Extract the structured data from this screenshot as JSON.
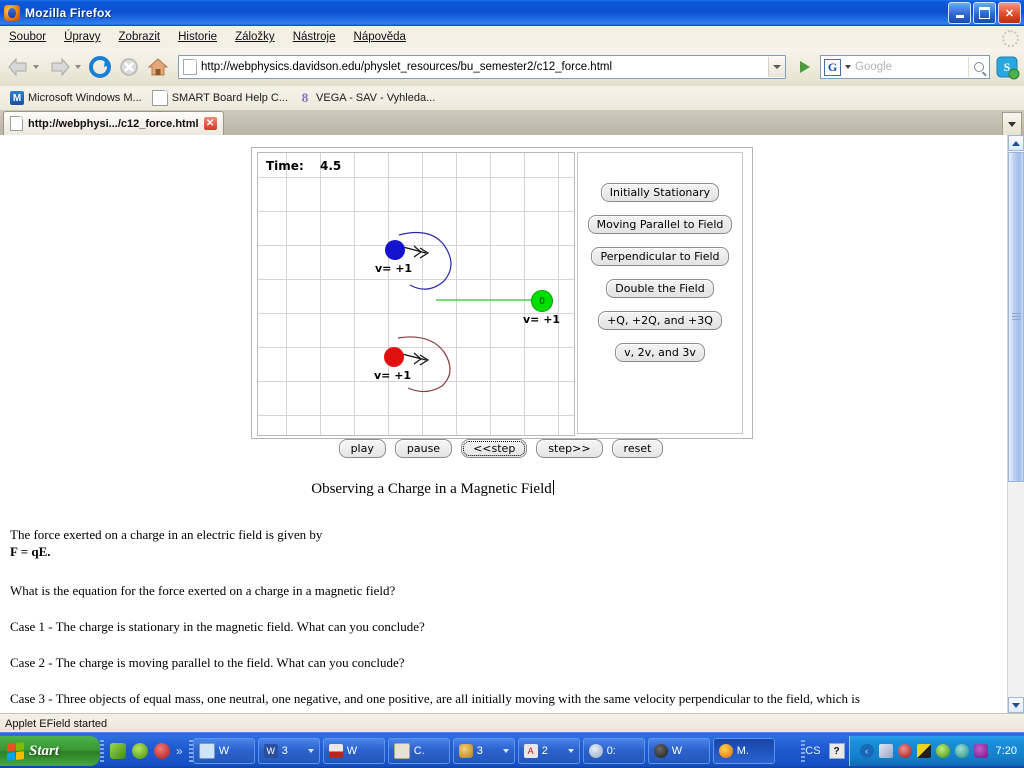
{
  "window": {
    "title": "Mozilla Firefox",
    "minimize_label": "_",
    "maximize_label": "□",
    "close_label": "✕"
  },
  "menubar": {
    "items": [
      {
        "label": "Soubor"
      },
      {
        "label": "Úpravy"
      },
      {
        "label": "Zobrazit"
      },
      {
        "label": "Historie"
      },
      {
        "label": "Záložky"
      },
      {
        "label": "Nástroje"
      },
      {
        "label": "Nápověda"
      }
    ]
  },
  "navbar": {
    "back_title": "Back",
    "forward_title": "Forward",
    "reload_title": "Reload",
    "stop_title": "Stop",
    "home_title": "Home",
    "url": "http://webphysics.davidson.edu/physlet_resources/bu_semester2/c12_force.html",
    "go_title": "Go",
    "search_engine": "G",
    "search_placeholder": "Google",
    "search_value": ""
  },
  "bookmarks": [
    {
      "label": "Microsoft Windows M...",
      "icon": "m-icon"
    },
    {
      "label": "SMART Board Help C...",
      "icon": "page-icon"
    },
    {
      "label": "VEGA - SAV - Vyhleda...",
      "icon": "eight-icon"
    }
  ],
  "tabs": [
    {
      "label": "http://webphysi.../c12_force.html",
      "close_label": "✕"
    }
  ],
  "applet": {
    "time_label": "Time:",
    "time_value": "4.5",
    "objects": [
      {
        "name": "blue-charge",
        "color": "#1414cc",
        "velocity_label": "v= +1",
        "inner": ""
      },
      {
        "name": "green-charge",
        "color": "#00e000",
        "velocity_label": "v= +1",
        "inner": "0"
      },
      {
        "name": "red-charge",
        "color": "#e11010",
        "velocity_label": "v= +1",
        "inner": ""
      }
    ],
    "scenario_buttons": [
      {
        "label": "Initially Stationary"
      },
      {
        "label": "Moving Parallel to Field"
      },
      {
        "label": "Perpendicular to Field"
      },
      {
        "label": "Double the Field"
      },
      {
        "label": "+Q, +2Q, and +3Q"
      },
      {
        "label": "v, 2v, and 3v"
      }
    ],
    "playback_buttons": [
      {
        "label": "play",
        "focused": false
      },
      {
        "label": "pause",
        "focused": false
      },
      {
        "label": "<<step",
        "focused": true
      },
      {
        "label": "step>>",
        "focused": false
      },
      {
        "label": "reset",
        "focused": false
      }
    ]
  },
  "document": {
    "title": "Observing a Charge in a Magnetic Field",
    "line1": "The force exerted on a charge in an electric field is given by",
    "formula": "F = qE.",
    "question": "What is the equation for the force exerted on a charge in a magnetic field?",
    "case1": "Case 1 - The charge is stationary in the magnetic field. What can you conclude?",
    "case2": "Case 2 - The charge is moving parallel to the field. What can you conclude?",
    "case3": "Case 3 - Three objects of equal mass, one neutral, one negative, and one positive, are all initially moving with the same velocity perpendicular to the field, which is"
  },
  "statusbar": {
    "text": "Applet EField started"
  },
  "taskbar": {
    "start_label": "Start",
    "tasks": [
      {
        "label": "W",
        "icon_color": "#cfe4f7",
        "has_caret": false,
        "active": false
      },
      {
        "label": "3",
        "icon_color": "#2a4f9e",
        "has_caret": true,
        "active": false
      },
      {
        "label": "W",
        "icon_color": "#d8d8d8",
        "has_caret": false,
        "active": false
      },
      {
        "label": "C.",
        "icon_color": "#e8e2d0",
        "has_caret": false,
        "active": false
      },
      {
        "label": "3",
        "icon_color": "#e8c46a",
        "has_caret": true,
        "active": false
      },
      {
        "label": "2",
        "icon_color": "#e8e8e8",
        "has_caret": true,
        "active": false
      },
      {
        "label": "0:",
        "icon_color": "#c8d4e4",
        "has_caret": false,
        "active": false
      },
      {
        "label": "W",
        "icon_color": "#2b2b2b",
        "has_caret": false,
        "active": false
      },
      {
        "label": "M.",
        "icon_color": "#f08a1c",
        "has_caret": false,
        "active": true
      }
    ],
    "language": "CS",
    "help_badge": "?",
    "tray_icons": [
      "#b9c8dc",
      "#c94b2a",
      "#3a3a3a",
      "#8fc64a",
      "#4aa8d8",
      "#9a1f8a"
    ],
    "clock": "7:20"
  }
}
